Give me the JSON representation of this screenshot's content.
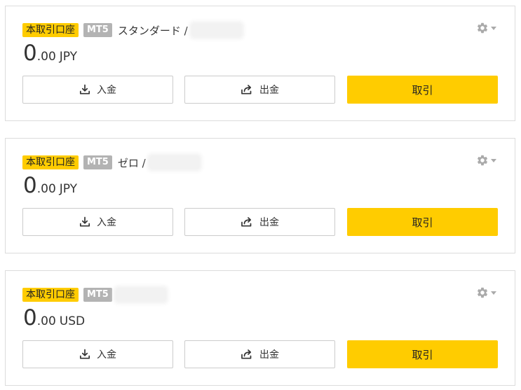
{
  "accounts": [
    {
      "badge_real": "本取引口座",
      "platform": "MT5",
      "account_type": "スタンダード /",
      "account_number": "",
      "balance_int": "0",
      "balance_dec": ".00",
      "currency": "JPY",
      "deposit_label": "入金",
      "withdraw_label": "出金",
      "trade_label": "取引"
    },
    {
      "badge_real": "本取引口座",
      "platform": "MT5",
      "account_type": "ゼロ /",
      "account_number": "",
      "balance_int": "0",
      "balance_dec": ".00",
      "currency": "JPY",
      "deposit_label": "入金",
      "withdraw_label": "出金",
      "trade_label": "取引"
    },
    {
      "badge_real": "本取引口座",
      "platform": "MT5",
      "account_type": "",
      "account_number": "",
      "balance_int": "0",
      "balance_dec": ".00",
      "currency": "USD",
      "deposit_label": "入金",
      "withdraw_label": "出金",
      "trade_label": "取引"
    }
  ],
  "icons": {
    "settings": "gear-icon",
    "settings_caret": "caret-down-icon",
    "deposit": "download-icon",
    "withdraw": "share-out-icon"
  },
  "colors": {
    "accent": "#ffcc00",
    "platform_badge": "#b3b3b3",
    "border": "#dcdcdc",
    "icon_gray": "#aaaaaa"
  }
}
